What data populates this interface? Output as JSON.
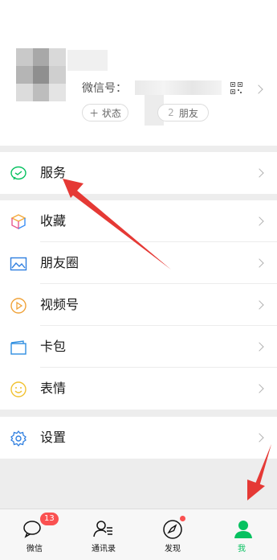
{
  "profile": {
    "wechat_id_label": "微信号：",
    "status_button": "＋ 状态",
    "friends_button": "朋友",
    "friends_count": "2"
  },
  "menu": {
    "services": "服务",
    "favorites": "收藏",
    "moments": "朋友圈",
    "channels": "视频号",
    "cards": "卡包",
    "stickers": "表情",
    "settings": "设置"
  },
  "tabbar": {
    "chats": "微信",
    "chats_badge": "13",
    "contacts": "通讯录",
    "discover": "发现",
    "me": "我"
  },
  "colors": {
    "accent": "#07c160",
    "badge": "#fa5151",
    "annotation_arrow": "#e53935"
  }
}
